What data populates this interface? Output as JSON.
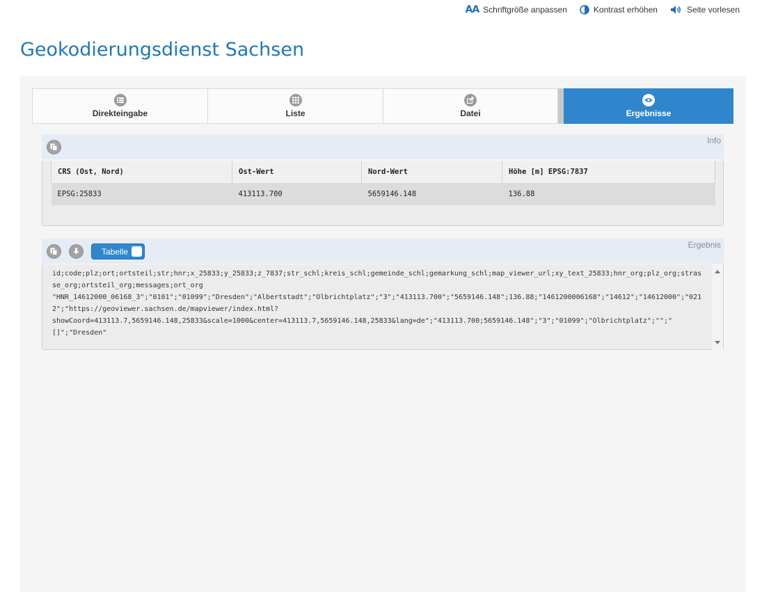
{
  "a11y": {
    "font_size": "Schriftgröße anpassen",
    "font_glyph": "AA",
    "contrast": "Kontrast erhöhen",
    "read_aloud": "Seite vorlesen"
  },
  "page_title": "Geokodierungsdienst Sachsen",
  "tabs": [
    {
      "label": "Direkteingabe",
      "icon": "list-icon"
    },
    {
      "label": "Liste",
      "icon": "grid-icon"
    },
    {
      "label": "Datei",
      "icon": "file-export-icon"
    },
    {
      "label": "Ergebnisse",
      "icon": "eye-icon",
      "active": true
    }
  ],
  "info": {
    "title": "Info",
    "columns": [
      "CRS (Ost, Nord)",
      "Ost-Wert",
      "Nord-Wert",
      "Höhe [m] EPSG:7837"
    ],
    "row": [
      "EPSG:25833",
      "413113.700",
      "5659146.148",
      "136.88"
    ]
  },
  "result": {
    "title": "Ergebnis",
    "toggle_label": "Tabelle",
    "text": "id;code;plz;ort;ortsteil;str;hnr;x_25833;y_25833;z_7837;str_schl;kreis_schl;gemeinde_schl;gemarkung_schl;map_viewer_url;xy_text_25833;hnr_org;plz_org;strasse_org;ortsteil_org;messages;ort_org\n\"HNR_14612000_06168_3\";\"0101\";\"01099\";\"Dresden\";\"Albertstadt\";\"Olbrichtplatz\";\"3\";\"413113.700\";\"5659146.148\";136.88;\"1461200006168\";\"14612\";\"14612000\";\"0212\";\"https://geoviewer.sachsen.de/mapviewer/index.html?\nshowCoord=413113.7,5659146.148,25833&scale=1000&center=413113.7,5659146.148,25833&lang=de\";\"413113.700;5659146.148\";\"3\";\"01099\";\"Olbrichtplatz\";\"\";\"\n[]\";\"Dresden\""
  },
  "colors": {
    "accent": "#2f86cc",
    "title": "#1f78b4",
    "section_head": "#e6ecf5"
  }
}
